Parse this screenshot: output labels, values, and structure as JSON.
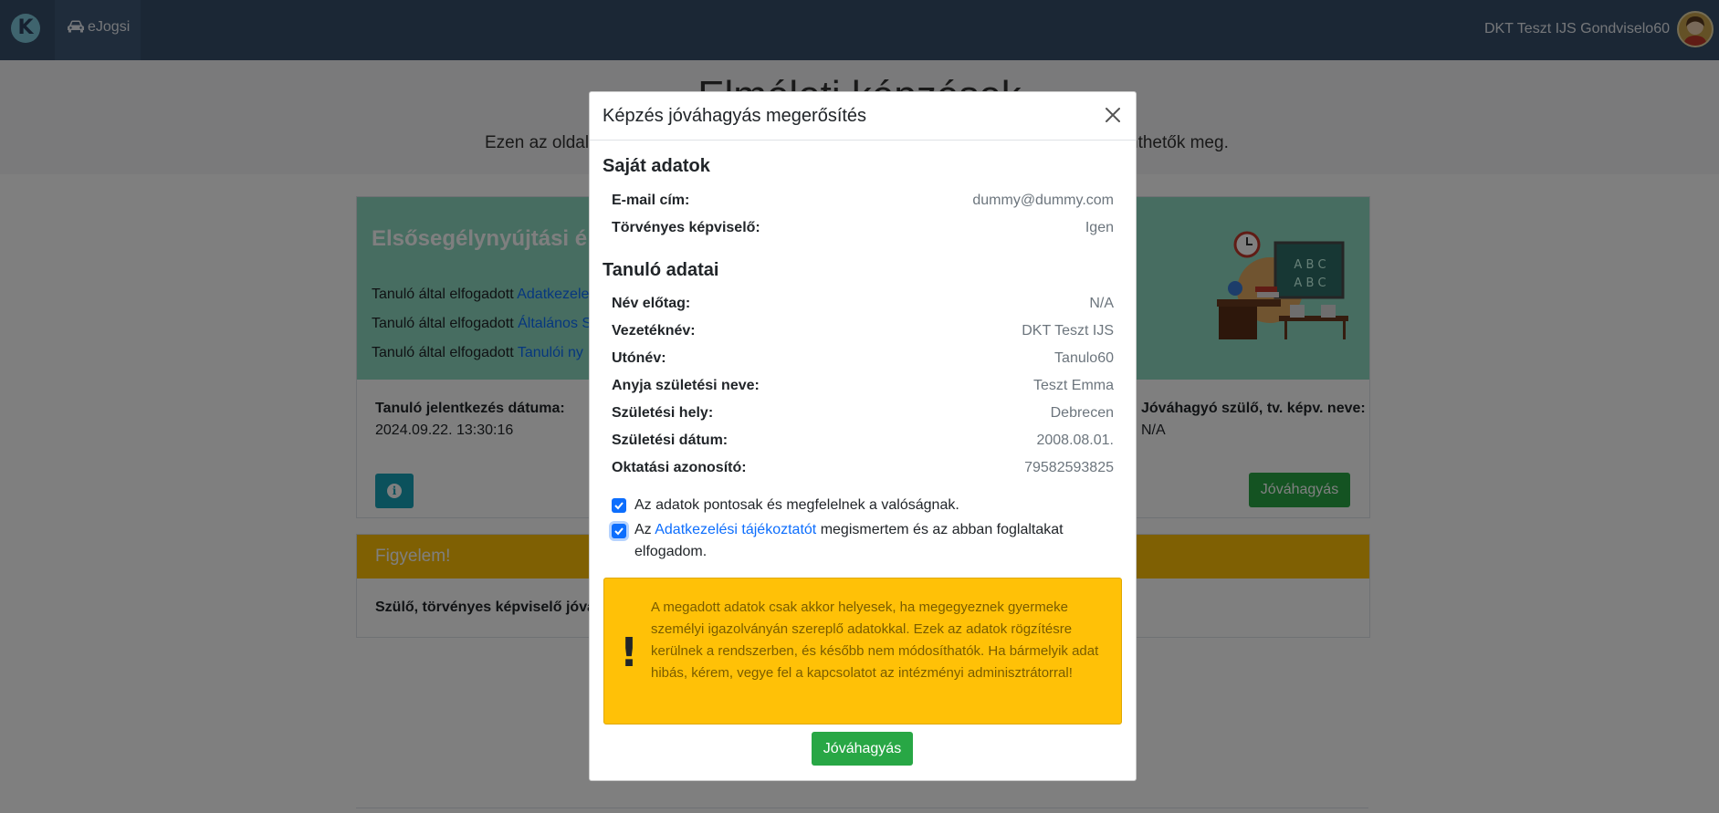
{
  "navbar": {
    "logo_letter": "K",
    "app_item": "eJogsi",
    "user_name": "DKT Teszt IJS Gondviselo60"
  },
  "page": {
    "title": "Elméleti képzések",
    "subtitle_start": "Ezen az oldal",
    "subtitle_end": "nthetők meg."
  },
  "course_card": {
    "title": "Elsősegélynyújtási é",
    "lines": [
      {
        "prefix": "Tanuló által elfogadott",
        "link": "Adatkezele"
      },
      {
        "prefix": "Tanuló által elfogadott",
        "link": "Általános S"
      },
      {
        "prefix": "Tanuló által elfogadott",
        "link": "Tanulói ny"
      }
    ],
    "reg_date_label": "Tanuló jelentkezés dátuma:",
    "reg_date_value": "2024.09.22. 13:30:16",
    "approver_label": "Jóváhagyó szülő, tv. képv. neve:",
    "approver_value": "N/A",
    "approve_button": "Jóváhagyás"
  },
  "warning_card": {
    "title": "Figyelem!",
    "body": "Szülő, törvényes képviselő jóváh"
  },
  "modal": {
    "title": "Képzés jóváhagyás megerősítés",
    "own_section": "Saját adatok",
    "own_rows": [
      {
        "label": "E-mail cím:",
        "value": "dummy@dummy.com"
      },
      {
        "label": "Törvényes képviselő:",
        "value": "Igen"
      }
    ],
    "student_section": "Tanuló adatai",
    "student_rows": [
      {
        "label": "Név előtag:",
        "value": "N/A"
      },
      {
        "label": "Vezetéknév:",
        "value": "DKT Teszt IJS"
      },
      {
        "label": "Utónév:",
        "value": "Tanulo60"
      },
      {
        "label": "Anyja születési neve:",
        "value": "Teszt Emma"
      },
      {
        "label": "Születési hely:",
        "value": "Debrecen"
      },
      {
        "label": "Születési dátum:",
        "value": "2008.08.01."
      },
      {
        "label": "Oktatási azonosító:",
        "value": "79582593825"
      }
    ],
    "checkbox1_text": "Az adatok pontosak és megfelelnek a valóságnak.",
    "checkbox2_prefix": "Az",
    "checkbox2_link": "Adatkezelési tájékoztatót",
    "checkbox2_suffix": "megismertem és az abban foglaltakat elfogadom.",
    "alert_mark": "!",
    "alert_text": "A megadott adatok csak akkor helyesek, ha megegyeznek gyermeke személyi igazolványán szereplő adatokkal. Ezek az adatok rögzítésre kerülnek a rendszerben, és később nem módosíthatók. Ha bármelyik adat hibás, kérem, vegye fel a kapcsolatot az intézményi adminisztrátorral!",
    "approve_button": "Jóváhagyás"
  },
  "colors": {
    "navbar": "#364f6b",
    "success": "#28a745",
    "warning": "#ffc107",
    "info": "#17a2b8",
    "link": "#0d6efd",
    "card_header": "#8fdac3"
  }
}
